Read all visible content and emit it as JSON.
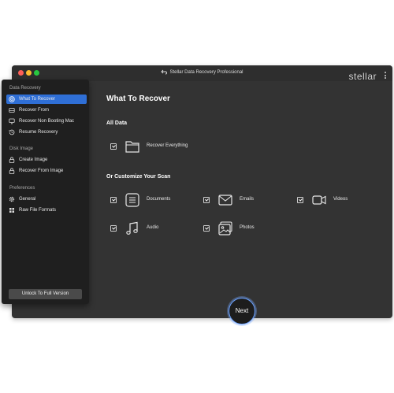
{
  "window": {
    "title": "Stellar Data Recovery Professional",
    "brand": "stellar"
  },
  "sidebar": {
    "sections": [
      {
        "label": "Data Recovery",
        "items": [
          {
            "label": "What To Recover",
            "icon": "target-icon",
            "active": true
          },
          {
            "label": "Recover From",
            "icon": "drive-icon"
          },
          {
            "label": "Recover Non Booting Mac",
            "icon": "monitor-icon"
          },
          {
            "label": "Resume Recovery",
            "icon": "history-icon"
          }
        ]
      },
      {
        "label": "Disk Image",
        "items": [
          {
            "label": "Create Image",
            "icon": "lock-icon"
          },
          {
            "label": "Recover From Image",
            "icon": "lock-icon"
          }
        ]
      },
      {
        "label": "Preferences",
        "items": [
          {
            "label": "General",
            "icon": "gear-icon"
          },
          {
            "label": "Raw File Formats",
            "icon": "grid-icon"
          }
        ]
      }
    ],
    "unlock_label": "Unlock To Full Version"
  },
  "main": {
    "title": "What To Recover",
    "all_data_heading": "All Data",
    "recover_everything": {
      "label": "Recover Everything",
      "checked": true,
      "icon": "folder-icon"
    },
    "customize_heading": "Or Customize Your Scan",
    "options": [
      {
        "label": "Documents",
        "checked": true,
        "icon": "document-icon"
      },
      {
        "label": "Emails",
        "checked": true,
        "icon": "email-icon"
      },
      {
        "label": "Videos",
        "checked": true,
        "icon": "video-icon"
      },
      {
        "label": "Audio",
        "checked": true,
        "icon": "audio-icon"
      },
      {
        "label": "Photos",
        "checked": true,
        "icon": "photo-icon"
      }
    ],
    "next_label": "Next"
  },
  "colors": {
    "accent": "#2f6fd6",
    "window_bg": "#333333",
    "sidebar_bg": "#1f1f1f"
  }
}
